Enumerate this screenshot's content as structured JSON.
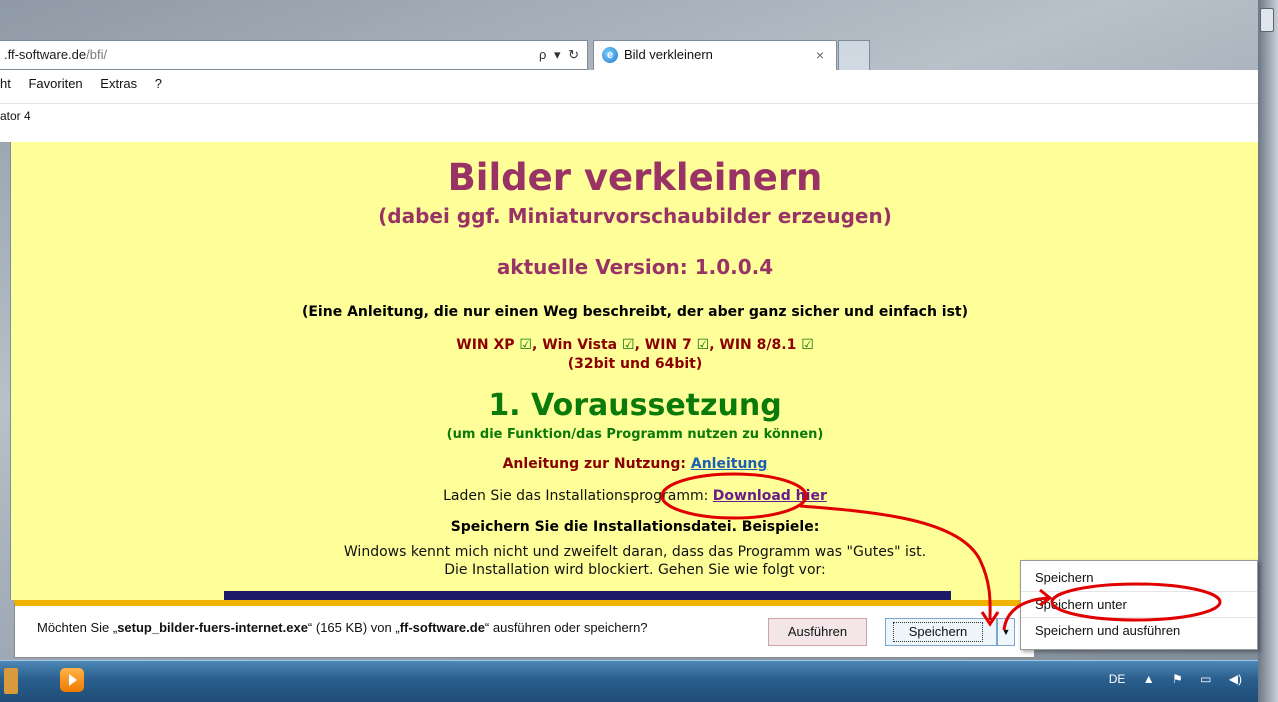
{
  "browser": {
    "address_host": ".ff-software.de",
    "address_path": "/bfi/",
    "address_tools": "ρ ▾ ↻",
    "tab_title": "Bild verkleinern",
    "tab_close": "×",
    "menu": [
      "ht",
      "Favoriten",
      "Extras",
      "?"
    ],
    "favorites": "ator 4"
  },
  "page": {
    "title": "Bilder verkleinern",
    "subtitle": "(dabei ggf. Miniaturvorschaubilder erzeugen)",
    "version": "aktuelle Version: 1.0.0.4",
    "hint": "(Eine Anleitung, die nur einen Weg beschreibt, der aber ganz sicher und einfach ist)",
    "os_list": [
      "WIN XP",
      "Win Vista",
      "WIN 7",
      "WIN 8/8.1"
    ],
    "check": "☑",
    "bits": "(32bit und 64bit)",
    "heading": "1. Voraussetzung",
    "heading_sub": "(um die Funktion/das Programm nutzen zu können)",
    "instructions_label": "Anleitung zur Nutzung:",
    "instructions_link": "Anleitung",
    "load_text": "Laden Sie das Installationsprogramm:",
    "download_link": "Download hier",
    "save_heading": "Speichern Sie die Installationsdatei. Beispiele:",
    "windows_line1": "Windows kennt mich nicht und zweifelt daran, dass das Programm was \"Gutes\" ist.",
    "windows_line2": "Die Installation wird blockiert. Gehen Sie wie folgt vor:"
  },
  "download_bar": {
    "prefix": "Möchten Sie „",
    "filename": "setup_bilder-fuers-internet.exe",
    "middle": "“ (165 KB) von „",
    "site": "ff-software.de",
    "suffix": "“ ausführen oder speichern?",
    "run_label": "Ausführen",
    "save_label": "Speichern",
    "arrow": "▼"
  },
  "save_menu": {
    "items": [
      "Speichern",
      "Speichern unter",
      "Speichern und ausführen"
    ]
  },
  "taskbar": {
    "language": "DE",
    "tray_icons": [
      "▲",
      "⚑",
      "▭",
      "◀)"
    ]
  },
  "colors": {
    "page_bg": "#ffff99",
    "title": "#993366",
    "heading": "#0a7a0a",
    "annotation": "#e00000",
    "notify_border": "#f0b400"
  }
}
